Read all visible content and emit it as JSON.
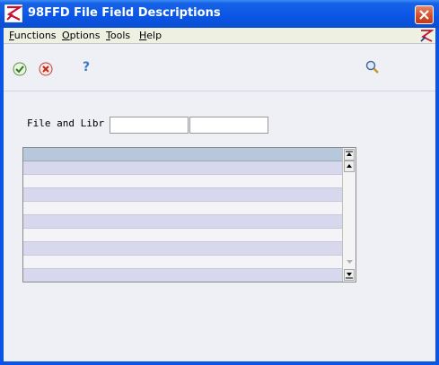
{
  "window": {
    "title": "98FFD   File Field Descriptions"
  },
  "menu": {
    "items": [
      {
        "first": "F",
        "rest": "unctions"
      },
      {
        "first": "O",
        "rest": "ptions"
      },
      {
        "first": "T",
        "rest": "ools"
      },
      {
        "first": "H",
        "rest": "elp"
      }
    ]
  },
  "toolbar": {
    "icons": [
      "ok-check-icon",
      "cancel-x-icon",
      "help-question-icon",
      "find-magnifier-icon"
    ],
    "help_glyph": "?"
  },
  "form": {
    "file_label": "File and Libr",
    "file_value": "",
    "library_value": ""
  },
  "grid": {
    "row_count": 9
  },
  "colors": {
    "title_bar": "#0A55E6",
    "background": "#EFEFF6",
    "row_alt": "#D7D7EE",
    "grid_header": "#B8C8DC"
  }
}
